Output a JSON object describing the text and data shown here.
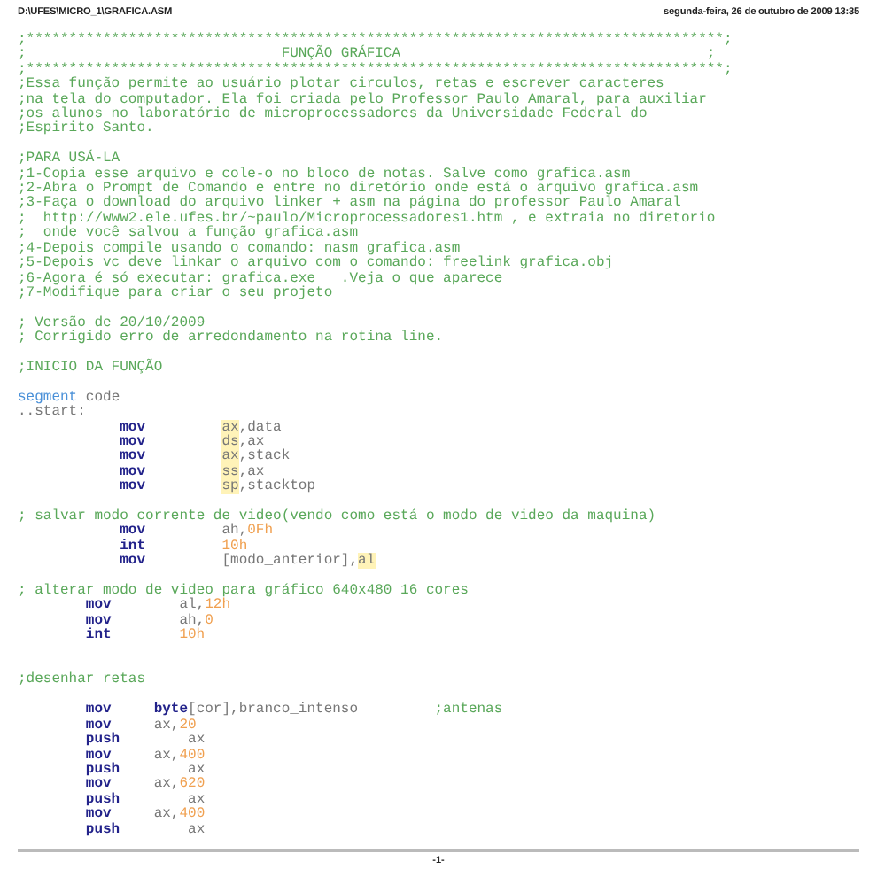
{
  "page_header": {
    "file_path": "D:\\UFES\\MICRO_1\\GRAFICA.ASM",
    "date": "segunda-feira, 26 de outubro de 2009 13:35"
  },
  "listing": [
    {
      "kind": "comment",
      "text": ";**********************************************************************************;"
    },
    {
      "kind": "comment",
      "text": ";                              FUNÇÃO GRÁFICA                                    ;"
    },
    {
      "kind": "comment",
      "text": ";**********************************************************************************;"
    },
    {
      "kind": "comment",
      "text": ";Essa função permite ao usuário plotar circulos, retas e escrever caracteres"
    },
    {
      "kind": "comment",
      "text": ";na tela do computador. Ela foi criada pelo Professor Paulo Amaral, para auxiliar"
    },
    {
      "kind": "comment",
      "text": ";os alunos no laboratório de microprocessadores da Universidade Federal do"
    },
    {
      "kind": "comment",
      "text": ";Espirito Santo."
    },
    {
      "kind": "blank"
    },
    {
      "kind": "comment",
      "text": ";PARA USÁ-LA"
    },
    {
      "kind": "comment",
      "text": ";1-Copia esse arquivo e cole-o no bloco de notas. Salve como grafica.asm"
    },
    {
      "kind": "comment",
      "text": ";2-Abra o Prompt de Comando e entre no diretório onde está o arquivo grafica.asm"
    },
    {
      "kind": "comment",
      "text": ";3-Faça o download do arquivo linker + asm na página do professor Paulo Amaral"
    },
    {
      "kind": "comment",
      "text": ";  http://www2.ele.ufes.br/~paulo/Microprocessadores1.htm , e extraia no diretorio"
    },
    {
      "kind": "comment",
      "text": ";  onde você salvou a função grafica.asm"
    },
    {
      "kind": "comment",
      "text": ";4-Depois compile usando o comando: nasm grafica.asm"
    },
    {
      "kind": "comment",
      "text": ";5-Depois vc deve linkar o arquivo com o comando: freelink grafica.obj"
    },
    {
      "kind": "comment",
      "text": ";6-Agora é só executar: grafica.exe   .Veja o que aparece"
    },
    {
      "kind": "comment",
      "text": ";7-Modifique para criar o seu projeto"
    },
    {
      "kind": "blank"
    },
    {
      "kind": "comment",
      "text": "; Versão de 20/10/2009"
    },
    {
      "kind": "comment",
      "text": "; Corrigido erro de arredondamento na rotina line."
    },
    {
      "kind": "blank"
    },
    {
      "kind": "comment",
      "text": ";INICIO DA FUNÇÃO"
    },
    {
      "kind": "blank"
    },
    {
      "kind": "directive",
      "keyword": "segment",
      "text": "code"
    },
    {
      "kind": "label",
      "text": "..start:"
    },
    {
      "kind": "op-wide",
      "mnemonic": "mov",
      "operands": [
        {
          "kind": "reg",
          "text": "ax"
        },
        {
          "kind": "plain",
          "text": ",data"
        }
      ]
    },
    {
      "kind": "op-wide",
      "mnemonic": "mov",
      "operands": [
        {
          "kind": "reg",
          "text": "ds"
        },
        {
          "kind": "plain",
          "text": ",ax"
        }
      ]
    },
    {
      "kind": "op-wide",
      "mnemonic": "mov",
      "operands": [
        {
          "kind": "reg",
          "text": "ax"
        },
        {
          "kind": "plain",
          "text": ",stack"
        }
      ]
    },
    {
      "kind": "op-wide",
      "mnemonic": "mov",
      "operands": [
        {
          "kind": "reg",
          "text": "ss"
        },
        {
          "kind": "plain",
          "text": ",ax"
        }
      ]
    },
    {
      "kind": "op-wide",
      "mnemonic": "mov",
      "operands": [
        {
          "kind": "reg",
          "text": "sp"
        },
        {
          "kind": "plain",
          "text": ",stacktop"
        }
      ]
    },
    {
      "kind": "blank"
    },
    {
      "kind": "comment",
      "text": "; salvar modo corrente de video(vendo como está o modo de video da maquina)"
    },
    {
      "kind": "op-wide",
      "mnemonic": "mov",
      "operands": [
        {
          "kind": "plain",
          "text": "ah,"
        },
        {
          "kind": "num",
          "text": "0Fh"
        }
      ]
    },
    {
      "kind": "op-wide",
      "mnemonic": "int",
      "operands": [
        {
          "kind": "num",
          "text": "10h"
        }
      ]
    },
    {
      "kind": "op-wide",
      "mnemonic": "mov",
      "operands": [
        {
          "kind": "plain",
          "text": "[modo_anterior],"
        },
        {
          "kind": "reg",
          "text": "al"
        }
      ]
    },
    {
      "kind": "blank"
    },
    {
      "kind": "comment",
      "text": "; alterar modo de video para gráfico 640x480 16 cores"
    },
    {
      "kind": "op-mid",
      "mnemonic": "mov",
      "operands": [
        {
          "kind": "plain",
          "text": "al,"
        },
        {
          "kind": "num",
          "text": "12h"
        }
      ]
    },
    {
      "kind": "op-mid",
      "mnemonic": "mov",
      "operands": [
        {
          "kind": "plain",
          "text": "ah,"
        },
        {
          "kind": "num",
          "text": "0"
        }
      ]
    },
    {
      "kind": "op-mid",
      "mnemonic": "int",
      "operands": [
        {
          "kind": "num",
          "text": "10h"
        }
      ]
    },
    {
      "kind": "blank"
    },
    {
      "kind": "blank"
    },
    {
      "kind": "comment",
      "text": ";desenhar retas"
    },
    {
      "kind": "blank"
    },
    {
      "kind": "op-narrow",
      "mnemonic": "mov",
      "operands": [
        {
          "kind": "bold",
          "text": "byte"
        },
        {
          "kind": "plain",
          "text": "[cor],branco_intenso"
        }
      ],
      "comment": ";antenas"
    },
    {
      "kind": "op-narrow",
      "mnemonic": "mov",
      "operands": [
        {
          "kind": "plain",
          "text": "ax,"
        },
        {
          "kind": "num",
          "text": "20"
        }
      ]
    },
    {
      "kind": "op-push",
      "mnemonic": "push",
      "operands": [
        {
          "kind": "plain",
          "text": "ax"
        }
      ]
    },
    {
      "kind": "op-narrow",
      "mnemonic": "mov",
      "operands": [
        {
          "kind": "plain",
          "text": "ax,"
        },
        {
          "kind": "num",
          "text": "400"
        }
      ]
    },
    {
      "kind": "op-push",
      "mnemonic": "push",
      "operands": [
        {
          "kind": "plain",
          "text": "ax"
        }
      ]
    },
    {
      "kind": "op-narrow",
      "mnemonic": "mov",
      "operands": [
        {
          "kind": "plain",
          "text": "ax,"
        },
        {
          "kind": "num",
          "text": "620"
        }
      ]
    },
    {
      "kind": "op-push",
      "mnemonic": "push",
      "operands": [
        {
          "kind": "plain",
          "text": "ax"
        }
      ]
    },
    {
      "kind": "op-narrow",
      "mnemonic": "mov",
      "operands": [
        {
          "kind": "plain",
          "text": "ax,"
        },
        {
          "kind": "num",
          "text": "400"
        }
      ]
    },
    {
      "kind": "op-push",
      "mnemonic": "push",
      "operands": [
        {
          "kind": "plain",
          "text": "ax"
        }
      ]
    }
  ],
  "page_footer": {
    "page_number": "-1-"
  }
}
